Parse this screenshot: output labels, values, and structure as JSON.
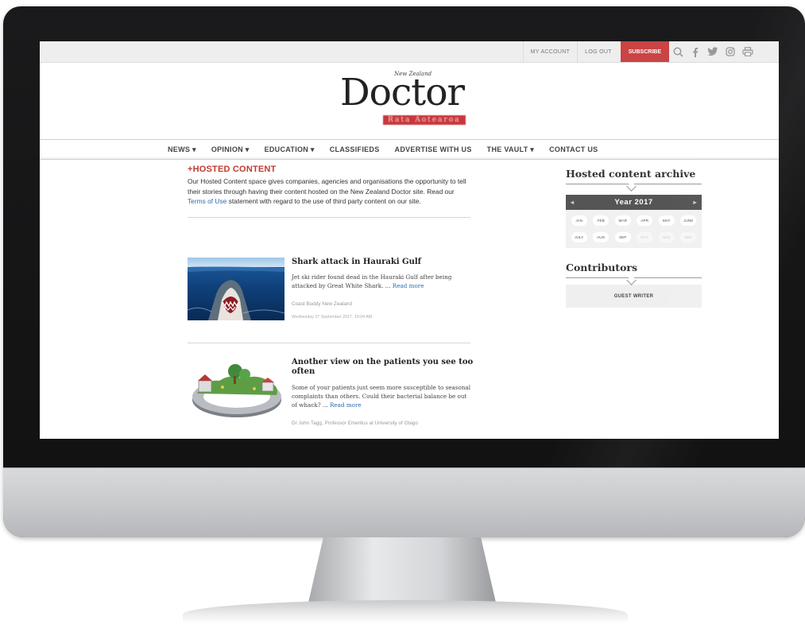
{
  "topbar": {
    "my_account": "MY ACCOUNT",
    "log_out": "LOG OUT",
    "subscribe": "SUBSCRIBE",
    "icons": [
      "search-icon",
      "facebook-icon",
      "twitter-icon",
      "instagram-icon",
      "print-icon"
    ]
  },
  "logo": {
    "small": "New Zealand",
    "word": "Doctor",
    "tag": "Rata Aotearoa"
  },
  "nav": {
    "items": [
      "NEWS ▾",
      "OPINION ▾",
      "EDUCATION ▾",
      "CLASSIFIEDS",
      "ADVERTISE WITH US",
      "THE VAULT ▾",
      "CONTACT US"
    ]
  },
  "main": {
    "section_title": "+HOSTED CONTENT",
    "intro_before": "Our Hosted Content space gives companies, agencies and organisations the opportunity to tell their stories through having their content hosted on the New Zealand Doctor site. Read our ",
    "intro_link": "Terms of Use",
    "intro_after": " statement with regard to the use of third party content on our site.",
    "articles": [
      {
        "title": "Shark attack in Hauraki Gulf",
        "summary": "Jet ski rider found dead in the Hauraki Gulf after being attacked by Great White Shark. ...",
        "read_more": "Read more",
        "byline": "Coast Buddy New Zealand",
        "date": "Wednesday 27 September 2017, 10:04 AM"
      },
      {
        "title": "Another view on the patients you see too often",
        "summary": "Some of your patients just seem more susceptible to seasonal complaints than others. Could their bacterial balance be out of whack? ...",
        "read_more": "Read more",
        "byline": "Dr John Tagg, Professor Emeritus at University of Otago",
        "date": ""
      }
    ]
  },
  "sidebar": {
    "archive_title": "Hosted content archive",
    "year": "Year 2017",
    "prev": "◂",
    "next": "▸",
    "months": [
      "JAN",
      "FEB",
      "MAR",
      "APR",
      "MAY",
      "JUNE",
      "JULY",
      "AUG",
      "SEP",
      "OCT",
      "NOV",
      "DEC"
    ],
    "months_enabled": [
      true,
      true,
      true,
      true,
      true,
      true,
      true,
      true,
      true,
      false,
      false,
      false
    ],
    "contributors_title": "Contributors",
    "guest_writer": "GUEST WRITER"
  },
  "colors": {
    "accent_red": "#c94444",
    "link_blue": "#2a6db2",
    "year_bar": "#555555"
  }
}
